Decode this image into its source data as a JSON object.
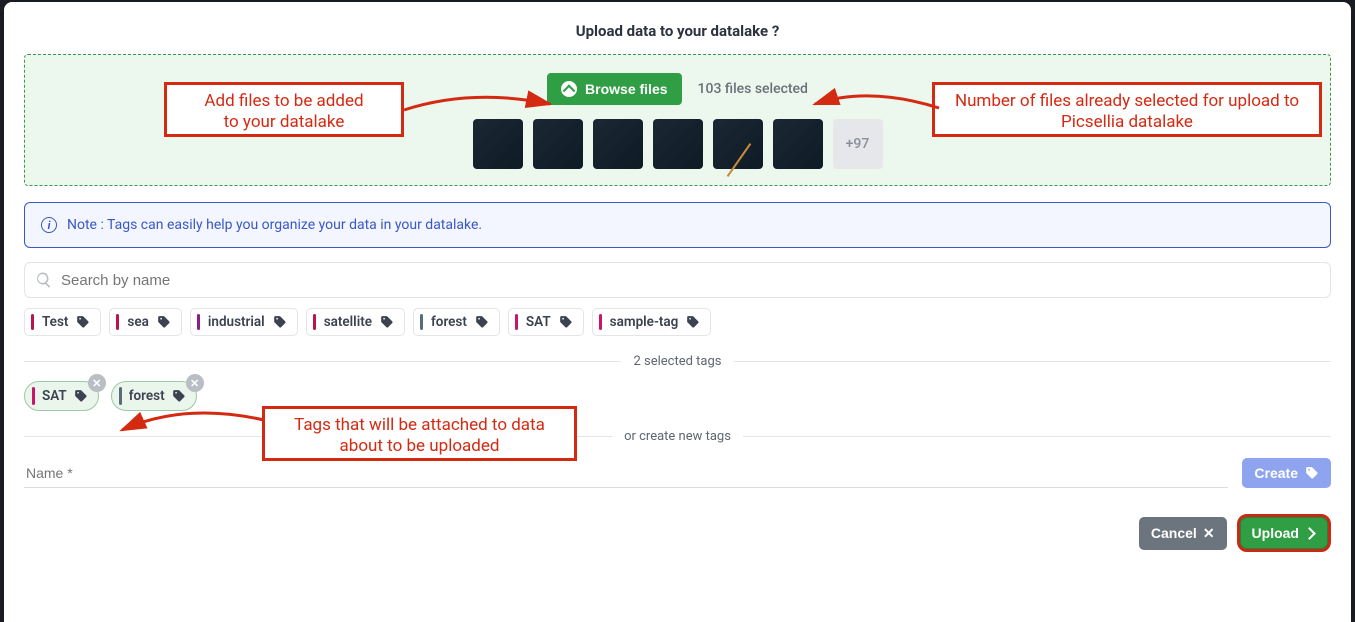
{
  "title": "Upload data to your datalake ?",
  "dropzone": {
    "browse_label": "Browse files",
    "selected_text": "103 files selected",
    "more_label": "+97"
  },
  "note_text": "Note : Tags can easily help you organize your data in your datalake.",
  "search_placeholder": "Search by name",
  "tags": [
    {
      "label": "Test",
      "bar": "#b9154a",
      "icon": "#e54ca4"
    },
    {
      "label": "sea",
      "bar": "#b9154a",
      "icon": "#e54ca4"
    },
    {
      "label": "industrial",
      "bar": "#8a1d88",
      "icon": "#b751c7"
    },
    {
      "label": "satellite",
      "bar": "#b9154a",
      "icon": "#e54ca4"
    },
    {
      "label": "forest",
      "bar": "#5a6b7a",
      "icon": "#8aa0b0"
    },
    {
      "label": "SAT",
      "bar": "#c9156d",
      "icon": "#e54ca4"
    },
    {
      "label": "sample-tag",
      "bar": "#c9156d",
      "icon": "#e54ca4"
    }
  ],
  "selected_tags_label": "2 selected tags",
  "selected": [
    {
      "label": "SAT",
      "bar": "#c9156d",
      "icon": "#e54ca4"
    },
    {
      "label": "forest",
      "bar": "#5a6b7a",
      "icon": "#8aa0b0"
    }
  ],
  "create_divider_label": "or create new tags",
  "name_placeholder": "Name *",
  "create_label": "Create",
  "cancel_label": "Cancel",
  "upload_label": "Upload",
  "annotations": {
    "a1": "Add files to be added\nto your datalake",
    "a2": "Number of files already selected for upload to Picsellia datalake",
    "a3": "Tags that will be attached to data about to be uploaded"
  }
}
